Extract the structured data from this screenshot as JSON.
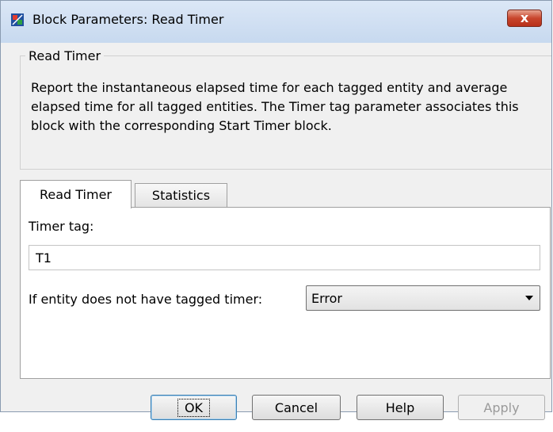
{
  "window": {
    "title": "Block Parameters: Read Timer",
    "close_label": "x"
  },
  "group": {
    "label": "Read Timer",
    "description": "Report the instantaneous elapsed time for each tagged entity and average elapsed time for all tagged entities. The Timer tag parameter associates this block with the corresponding Start Timer block."
  },
  "tabs": [
    {
      "label": "Read Timer",
      "active": true
    },
    {
      "label": "Statistics",
      "active": false
    }
  ],
  "fields": {
    "timer_tag_label": "Timer tag:",
    "timer_tag_value": "T1",
    "no_timer_label": "If entity does not have tagged timer:",
    "no_timer_value": "Error"
  },
  "buttons": {
    "ok": "OK",
    "cancel": "Cancel",
    "help": "Help",
    "apply": "Apply"
  },
  "colors": {
    "titlebar": "#c7d9ef",
    "close": "#c8452c",
    "default_button_border": "#3c7fb1"
  },
  "icons": {
    "window_icon": "simulink-block-icon",
    "dropdown": "chevron-down-icon"
  }
}
